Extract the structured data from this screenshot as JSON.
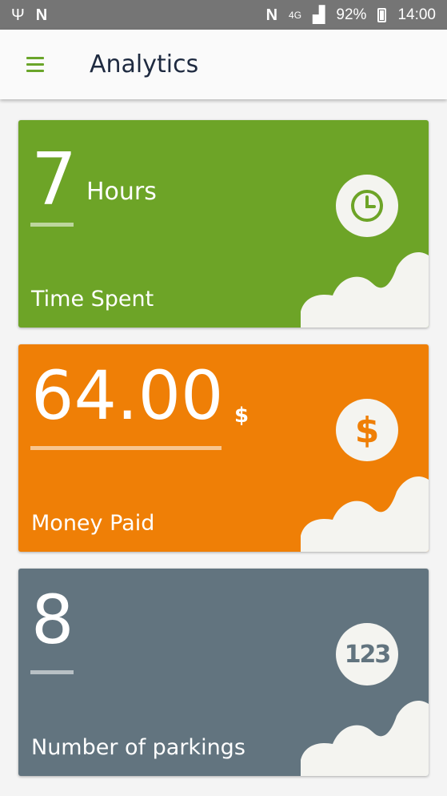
{
  "statusbar": {
    "battery": "92%",
    "time": "14:00",
    "network": "4G"
  },
  "appbar": {
    "title": "Analytics"
  },
  "cards": [
    {
      "value": "7",
      "unit": "Hours",
      "label": "Time Spent",
      "icon": "clock-icon",
      "color": "#6da427"
    },
    {
      "value": "64.00",
      "unit": "$",
      "label": "Money Paid",
      "icon": "dollar-icon",
      "color": "#ef7f06"
    },
    {
      "value": "8",
      "unit": "",
      "label": "Number of parkings",
      "icon": "numbers-icon",
      "icon_text": "123",
      "color": "#62747f"
    }
  ]
}
